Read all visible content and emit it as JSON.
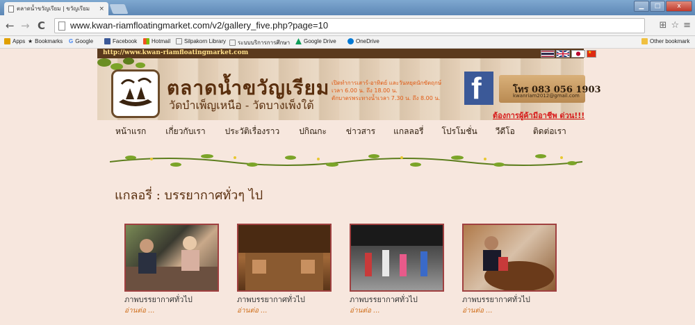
{
  "browser": {
    "tab_title": "ตลาดน้ำขวัญเรียม | ขวัญเรียม",
    "tab_close": "×",
    "url": "www.kwan-riamfloatingmarket.com/v2/gallery_five.php?page=10",
    "back": "←",
    "forward": "→",
    "reload": "C",
    "win_min": "▁",
    "win_max": "□",
    "win_close": "x",
    "bookmarks": [
      {
        "label": "Apps",
        "color": "#e0a000"
      },
      {
        "label": "Bookmarks",
        "color": "#444444"
      },
      {
        "label": "Google",
        "color": "#4285f4"
      },
      {
        "label": "Facebook",
        "color": "#3b5998"
      },
      {
        "label": "Hotmail",
        "color": "#f25022"
      },
      {
        "label": "Silpakorn Library",
        "color": "#888888"
      },
      {
        "label": "ระบบบริการการศึกษา",
        "color": "#888888"
      },
      {
        "label": "Google Drive",
        "color": "#0f9d58"
      },
      {
        "label": "OneDrive",
        "color": "#0078d4"
      }
    ],
    "other_bookmarks": "Other bookmark"
  },
  "site": {
    "header_url": "http://www.kwan-riamfloatingmarket.com",
    "title": "ตลาดน้ำขวัญเรียม",
    "subtitle": "วัดบำเพ็ญเหนือ - วัดบางเพ็งใต้",
    "hours": [
      "เปิดทำการเสาร์-อาทิตย์ และวันหยุดนักขัตฤกษ์",
      "เวลา 6.00 น. ถึง 18.00 น.",
      "ตักบาตรพระทางน้ำเวลา 7.30 น. ถึง 8.00 น."
    ],
    "phone": "โทร 083 056 1903",
    "email": "kwanriam2012@gmail.com",
    "wanted": "ต้องการผู้ค้ามีอาชีพ ด่วน!!!",
    "facebook": "f"
  },
  "menu": [
    "หน้าแรก",
    "เกี่ยวกับเรา",
    "ประวัติเรื่องราว",
    "ปกิณกะ",
    "ข่าวสาร",
    "แกลลอรี่",
    "โปรโมชั่น",
    "วีดีโอ",
    "ติดต่อเรา"
  ],
  "section_title": "แกลอรี่ : บรรยากาศทั่วๆ ไป",
  "gallery": [
    {
      "caption": "ภาพบรรยากาศทั่วไป",
      "more": "อ่านต่อ ..."
    },
    {
      "caption": "ภาพบรรยากาศทั่วไป",
      "more": "อ่านต่อ ..."
    },
    {
      "caption": "ภาพบรรยากาศทั่วไป",
      "more": "อ่านต่อ ..."
    },
    {
      "caption": "ภาพบรรยากาศทั่วไป",
      "more": "อ่านต่อ ..."
    }
  ]
}
